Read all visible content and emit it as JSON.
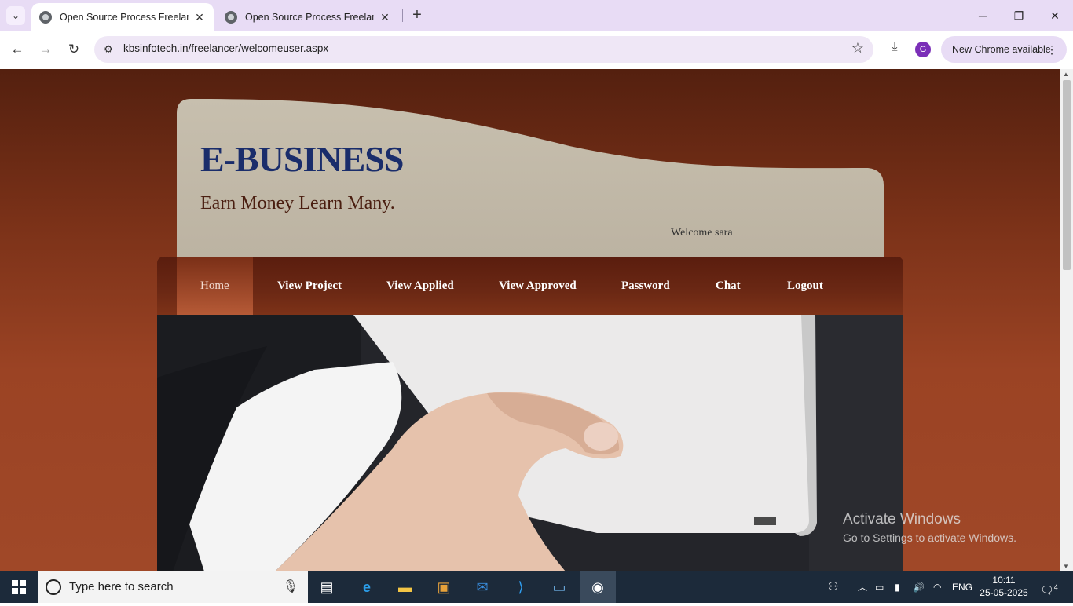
{
  "browser": {
    "tabs": [
      {
        "title": "Open Source Process Freelance",
        "active": true
      },
      {
        "title": "Open Source Process Freelance",
        "active": false
      }
    ],
    "new_tab": "+",
    "url": "kbsinfotech.in/freelancer/welcomeuser.aspx",
    "profile_initial": "G",
    "update_label": "New Chrome available"
  },
  "site": {
    "title": "E-BUSINESS",
    "tagline": "Earn Money Learn Many.",
    "welcome": "Welcome sara",
    "menu": [
      {
        "label": "Home",
        "active": true
      },
      {
        "label": "View Project"
      },
      {
        "label": "View Applied"
      },
      {
        "label": "View Approved"
      },
      {
        "label": "Password"
      },
      {
        "label": "Chat"
      },
      {
        "label": "Logout"
      }
    ],
    "hero_image": "hand-holding-laptop"
  },
  "watermark": {
    "line1": "Activate Windows",
    "line2": "Go to Settings to activate Windows."
  },
  "taskbar": {
    "search_placeholder": "Type here to search",
    "apps": [
      "task-view",
      "edge",
      "file-explorer",
      "store",
      "mail",
      "vscode",
      "app",
      "chrome"
    ],
    "language": "ENG",
    "time": "10:11",
    "date": "25-05-2025",
    "notification_count": "4"
  },
  "colors": {
    "page_bg": "#7a3118",
    "header_panel": "#c3b9a8",
    "title_blue": "#1a2d6b",
    "menubar": "#5a1d0e",
    "tab_strip": "#e8dcf5"
  }
}
